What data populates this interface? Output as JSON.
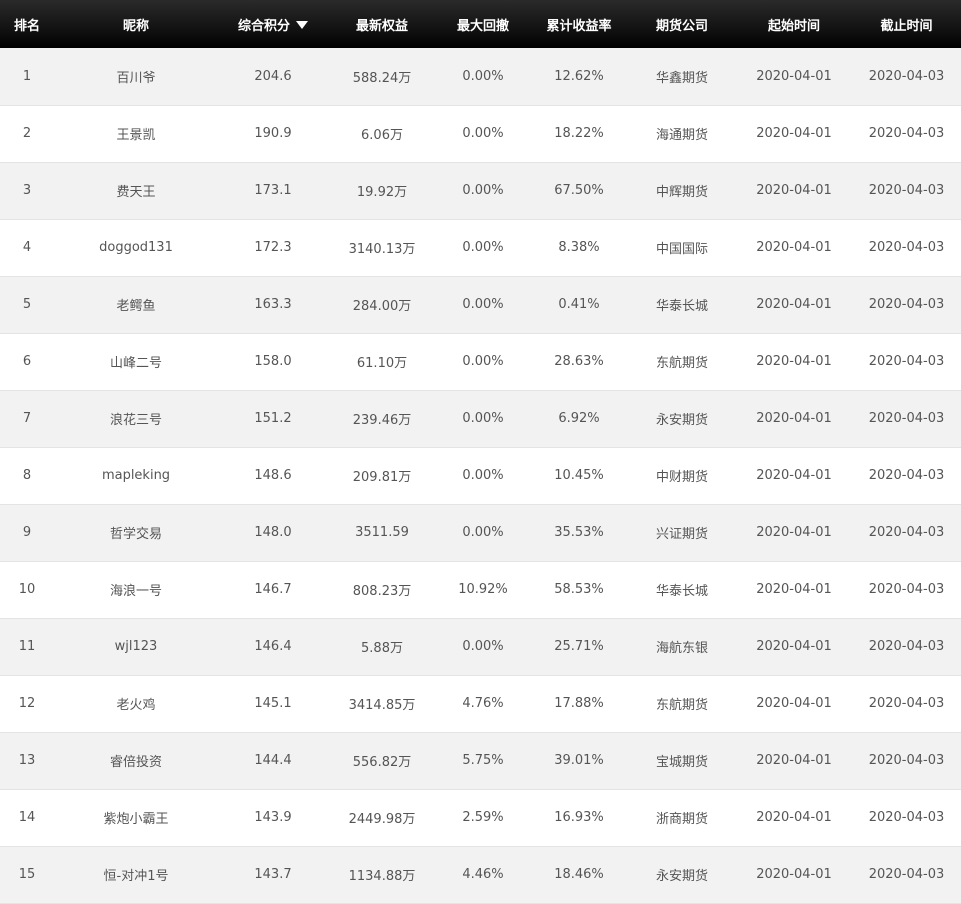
{
  "table": {
    "headers": {
      "rank": "排名",
      "nickname": "昵称",
      "score": "综合积分",
      "equity": "最新权益",
      "drawdown": "最大回撤",
      "return": "累计收益率",
      "company": "期货公司",
      "start": "起始时间",
      "end": "截止时间"
    },
    "sort_icon": "sort-desc-icon",
    "rows": [
      {
        "rank": "1",
        "nickname": "百川爷",
        "score": "204.6",
        "equity": "588.24万",
        "drawdown": "0.00%",
        "return": "12.62%",
        "company": "华鑫期货",
        "start": "2020-04-01",
        "end": "2020-04-03"
      },
      {
        "rank": "2",
        "nickname": "王景凯",
        "score": "190.9",
        "equity": "6.06万",
        "drawdown": "0.00%",
        "return": "18.22%",
        "company": "海通期货",
        "start": "2020-04-01",
        "end": "2020-04-03"
      },
      {
        "rank": "3",
        "nickname": "费天王",
        "score": "173.1",
        "equity": "19.92万",
        "drawdown": "0.00%",
        "return": "67.50%",
        "company": "中辉期货",
        "start": "2020-04-01",
        "end": "2020-04-03"
      },
      {
        "rank": "4",
        "nickname": "doggod131",
        "score": "172.3",
        "equity": "3140.13万",
        "drawdown": "0.00%",
        "return": "8.38%",
        "company": "中国国际",
        "start": "2020-04-01",
        "end": "2020-04-03"
      },
      {
        "rank": "5",
        "nickname": "老鳄鱼",
        "score": "163.3",
        "equity": "284.00万",
        "drawdown": "0.00%",
        "return": "0.41%",
        "company": "华泰长城",
        "start": "2020-04-01",
        "end": "2020-04-03"
      },
      {
        "rank": "6",
        "nickname": "山峰二号",
        "score": "158.0",
        "equity": "61.10万",
        "drawdown": "0.00%",
        "return": "28.63%",
        "company": "东航期货",
        "start": "2020-04-01",
        "end": "2020-04-03"
      },
      {
        "rank": "7",
        "nickname": "浪花三号",
        "score": "151.2",
        "equity": "239.46万",
        "drawdown": "0.00%",
        "return": "6.92%",
        "company": "永安期货",
        "start": "2020-04-01",
        "end": "2020-04-03"
      },
      {
        "rank": "8",
        "nickname": "mapleking",
        "score": "148.6",
        "equity": "209.81万",
        "drawdown": "0.00%",
        "return": "10.45%",
        "company": "中财期货",
        "start": "2020-04-01",
        "end": "2020-04-03"
      },
      {
        "rank": "9",
        "nickname": "哲学交易",
        "score": "148.0",
        "equity": "3511.59",
        "drawdown": "0.00%",
        "return": "35.53%",
        "company": "兴证期货",
        "start": "2020-04-01",
        "end": "2020-04-03"
      },
      {
        "rank": "10",
        "nickname": "海浪一号",
        "score": "146.7",
        "equity": "808.23万",
        "drawdown": "10.92%",
        "return": "58.53%",
        "company": "华泰长城",
        "start": "2020-04-01",
        "end": "2020-04-03"
      },
      {
        "rank": "11",
        "nickname": "wjl123",
        "score": "146.4",
        "equity": "5.88万",
        "drawdown": "0.00%",
        "return": "25.71%",
        "company": "海航东银",
        "start": "2020-04-01",
        "end": "2020-04-03"
      },
      {
        "rank": "12",
        "nickname": "老火鸡",
        "score": "145.1",
        "equity": "3414.85万",
        "drawdown": "4.76%",
        "return": "17.88%",
        "company": "东航期货",
        "start": "2020-04-01",
        "end": "2020-04-03"
      },
      {
        "rank": "13",
        "nickname": "睿倍投资",
        "score": "144.4",
        "equity": "556.82万",
        "drawdown": "5.75%",
        "return": "39.01%",
        "company": "宝城期货",
        "start": "2020-04-01",
        "end": "2020-04-03"
      },
      {
        "rank": "14",
        "nickname": "紫炮小霸王",
        "score": "143.9",
        "equity": "2449.98万",
        "drawdown": "2.59%",
        "return": "16.93%",
        "company": "浙商期货",
        "start": "2020-04-01",
        "end": "2020-04-03"
      },
      {
        "rank": "15",
        "nickname": "恒-对冲1号",
        "score": "143.7",
        "equity": "1134.88万",
        "drawdown": "4.46%",
        "return": "18.46%",
        "company": "永安期货",
        "start": "2020-04-01",
        "end": "2020-04-03"
      }
    ]
  }
}
